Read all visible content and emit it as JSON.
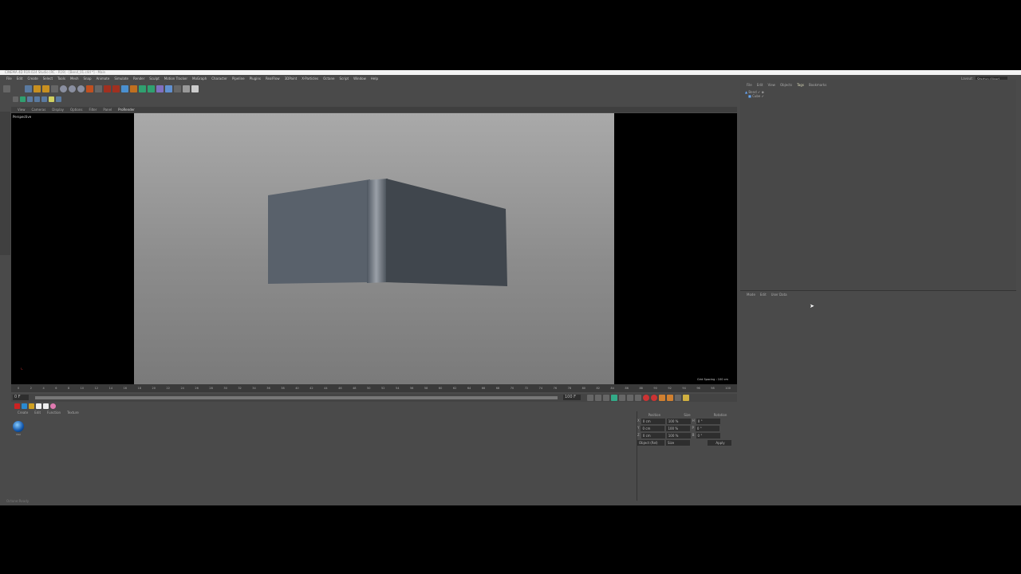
{
  "window": {
    "title": "CINEMA 4D R19.024 Studio (RC - R19) - [Bend_01.c4d *] - Main"
  },
  "menu": [
    "File",
    "Edit",
    "Create",
    "Select",
    "Tools",
    "Mesh",
    "Snap",
    "Animate",
    "Simulate",
    "Render",
    "Sculpt",
    "Motion Tracker",
    "MoGraph",
    "Character",
    "Pipeline",
    "Plugins",
    "RealFlow",
    "3DPaint",
    "X-Particles",
    "Octane",
    "Script",
    "Window",
    "Help"
  ],
  "layout": {
    "label": "Layout:",
    "value": "Startup (User)"
  },
  "viewport": {
    "menu": [
      "View",
      "Cameras",
      "Display",
      "Options",
      "Filter",
      "Panel",
      "ProRender"
    ],
    "name": "Perspective",
    "grid": "Grid Spacing : 100 cm"
  },
  "timeline": {
    "ticks": [
      "0",
      "2",
      "4",
      "6",
      "8",
      "10",
      "12",
      "14",
      "16",
      "18",
      "20",
      "22",
      "24",
      "26",
      "28",
      "30",
      "32",
      "34",
      "36",
      "38",
      "40",
      "42",
      "44",
      "46",
      "48",
      "50",
      "52",
      "54",
      "56",
      "58",
      "60",
      "62",
      "64",
      "66",
      "68",
      "70",
      "72",
      "74",
      "76",
      "78",
      "80",
      "82",
      "84",
      "86",
      "88",
      "90",
      "92",
      "94",
      "96",
      "98",
      "100"
    ],
    "start": "0 F",
    "end": "100 F",
    "current": "0 F"
  },
  "materials": {
    "menu": [
      "Create",
      "Edit",
      "Function",
      "Texture"
    ],
    "item": "Mat"
  },
  "coords": {
    "headers": [
      "Position",
      "Size",
      "Rotation"
    ],
    "rows": [
      {
        "axis": "X",
        "pos": "0 cm",
        "size": "100 %",
        "rot_label": "H",
        "rot": "0 °"
      },
      {
        "axis": "Y",
        "pos": "0 cm",
        "size": "100 %",
        "rot_label": "P",
        "rot": "0 °"
      },
      {
        "axis": "Z",
        "pos": "0 cm",
        "size": "100 %",
        "rot_label": "B",
        "rot": "0 °"
      }
    ],
    "mode": "Object (Rel)",
    "size_mode": "Size",
    "apply": "Apply"
  },
  "objects": {
    "menu": [
      "File",
      "Edit",
      "View",
      "Objects",
      "Tags",
      "Bookmarks"
    ],
    "items": [
      "Bend",
      "Cube"
    ]
  },
  "attributes": {
    "menu": [
      "Mode",
      "Edit",
      "User Data"
    ]
  },
  "status": "Octane:Ready"
}
